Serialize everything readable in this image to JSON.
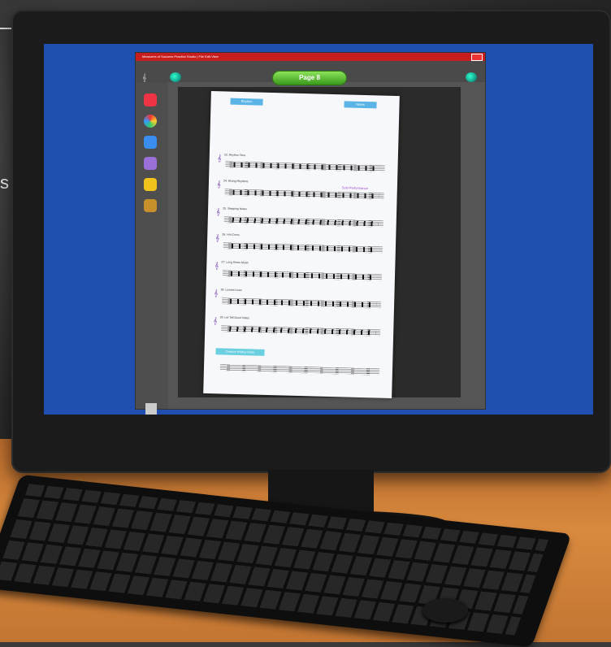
{
  "window": {
    "title": "Measures of Success Practice Studio  |  File  Edit  View"
  },
  "toolbar": {
    "page_button_label": "Page 8"
  },
  "sheet": {
    "section_left_header": "Rhythm",
    "section_right_header": "Notes",
    "exercises": [
      "23. Rhythm Time",
      "24. Rising Rhythms",
      "25. Stepping Notes",
      "26. Hot Cross",
      "27. Long Rests Music",
      "28. Lowest Lines",
      "29. Let Tell Good Notes"
    ],
    "purple_heading": "Solo Performance",
    "footer_box": "Creative Writing Studio"
  },
  "colors": {
    "screen": "#1f4fb0",
    "titlebar": "#c81d1d",
    "page_button": "#5ec534",
    "header_blue": "#5ab4e6"
  },
  "icons": [
    "logo-icon",
    "globe-icon",
    "home-icon",
    "color-wheel-icon",
    "hand-icon",
    "pencil-icon",
    "folder-icon",
    "bookmark-icon",
    "list-icon"
  ]
}
